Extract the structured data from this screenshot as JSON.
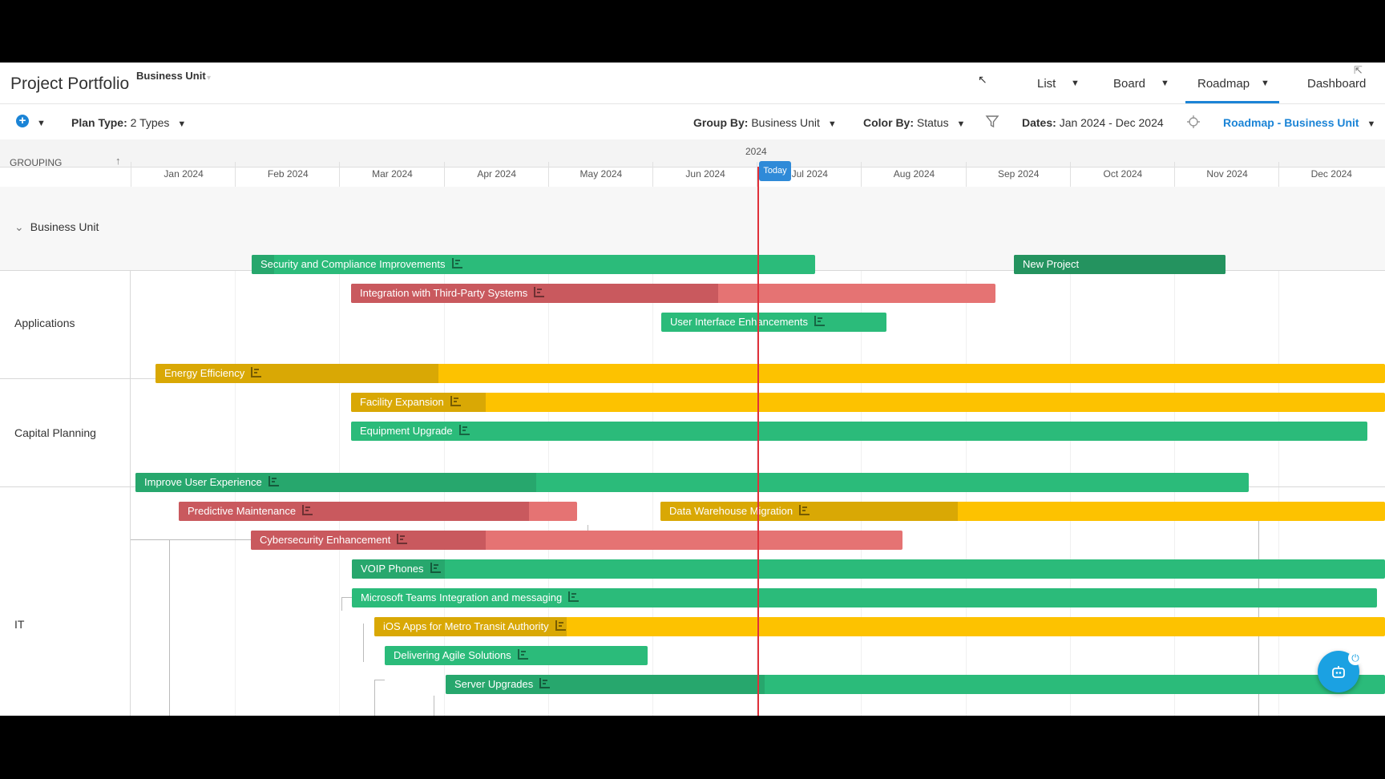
{
  "header": {
    "title": "Project Portfolio",
    "subtitle": "Business Unit",
    "tabs": [
      {
        "label": "List"
      },
      {
        "label": "Board"
      },
      {
        "label": "Roadmap"
      },
      {
        "label": "Dashboard"
      }
    ],
    "active_tab": "Roadmap"
  },
  "toolbar": {
    "plan_type_label": "Plan Type:",
    "plan_type_value": "2 Types",
    "group_by_label": "Group By:",
    "group_by_value": "Business Unit",
    "color_by_label": "Color By:",
    "color_by_value": "Status",
    "dates_label": "Dates:",
    "dates_value": "Jan 2024 - Dec 2024",
    "view_name": "Roadmap - Business Unit"
  },
  "timeline": {
    "grouping_label": "GROUPING",
    "year": "2024",
    "months": [
      "Jan 2024",
      "Feb 2024",
      "Mar 2024",
      "Apr 2024",
      "May 2024",
      "Jun 2024",
      "Jul 2024",
      "Aug 2024",
      "Sep 2024",
      "Oct 2024",
      "Nov 2024",
      "Dec 2024"
    ],
    "today_label": "Today"
  },
  "groups": {
    "business_unit": "Business Unit",
    "applications": "Applications",
    "capital_planning": "Capital Planning",
    "it": "IT"
  },
  "colors": {
    "green": "#2bbb7a",
    "green_progress": "#27a76d",
    "red": "#e57373",
    "red_progress": "#c9595e",
    "yellow": "#fdc200",
    "yellow_progress": "#d9a805",
    "dark_green": "#24935f"
  },
  "projects": [
    {
      "name": "Security and Compliance Improvements",
      "status": "green",
      "progress": 0.04
    },
    {
      "name": "New Project",
      "status": "dark_green",
      "progress": 1.0
    },
    {
      "name": "Integration with Third-Party Systems",
      "status": "red",
      "progress": 0.57
    },
    {
      "name": "User Interface Enhancements",
      "status": "green",
      "progress": 0.0
    },
    {
      "name": "Energy Efficiency",
      "status": "yellow",
      "progress": 0.23
    },
    {
      "name": "Facility Expansion",
      "status": "yellow",
      "progress": 0.13
    },
    {
      "name": "Equipment Upgrade",
      "status": "green",
      "progress": 0.0
    },
    {
      "name": "Improve User Experience",
      "status": "green",
      "progress": 0.36
    },
    {
      "name": "Predictive Maintenance",
      "status": "red",
      "progress": 0.88
    },
    {
      "name": "Data Warehouse Migration",
      "status": "yellow",
      "progress": 0.41
    },
    {
      "name": "Cybersecurity Enhancement",
      "status": "red",
      "progress": 0.36
    },
    {
      "name": "VOIP Phones",
      "status": "green",
      "progress": 0.09
    },
    {
      "name": "Microsoft Teams Integration and messaging",
      "status": "green",
      "progress": 0.0
    },
    {
      "name": "iOS Apps for Metro Transit Authority",
      "status": "yellow",
      "progress": 0.19
    },
    {
      "name": "Delivering Agile Solutions",
      "status": "green",
      "progress": 0.0
    },
    {
      "name": "Server Upgrades",
      "status": "green",
      "progress": 0.34
    }
  ]
}
